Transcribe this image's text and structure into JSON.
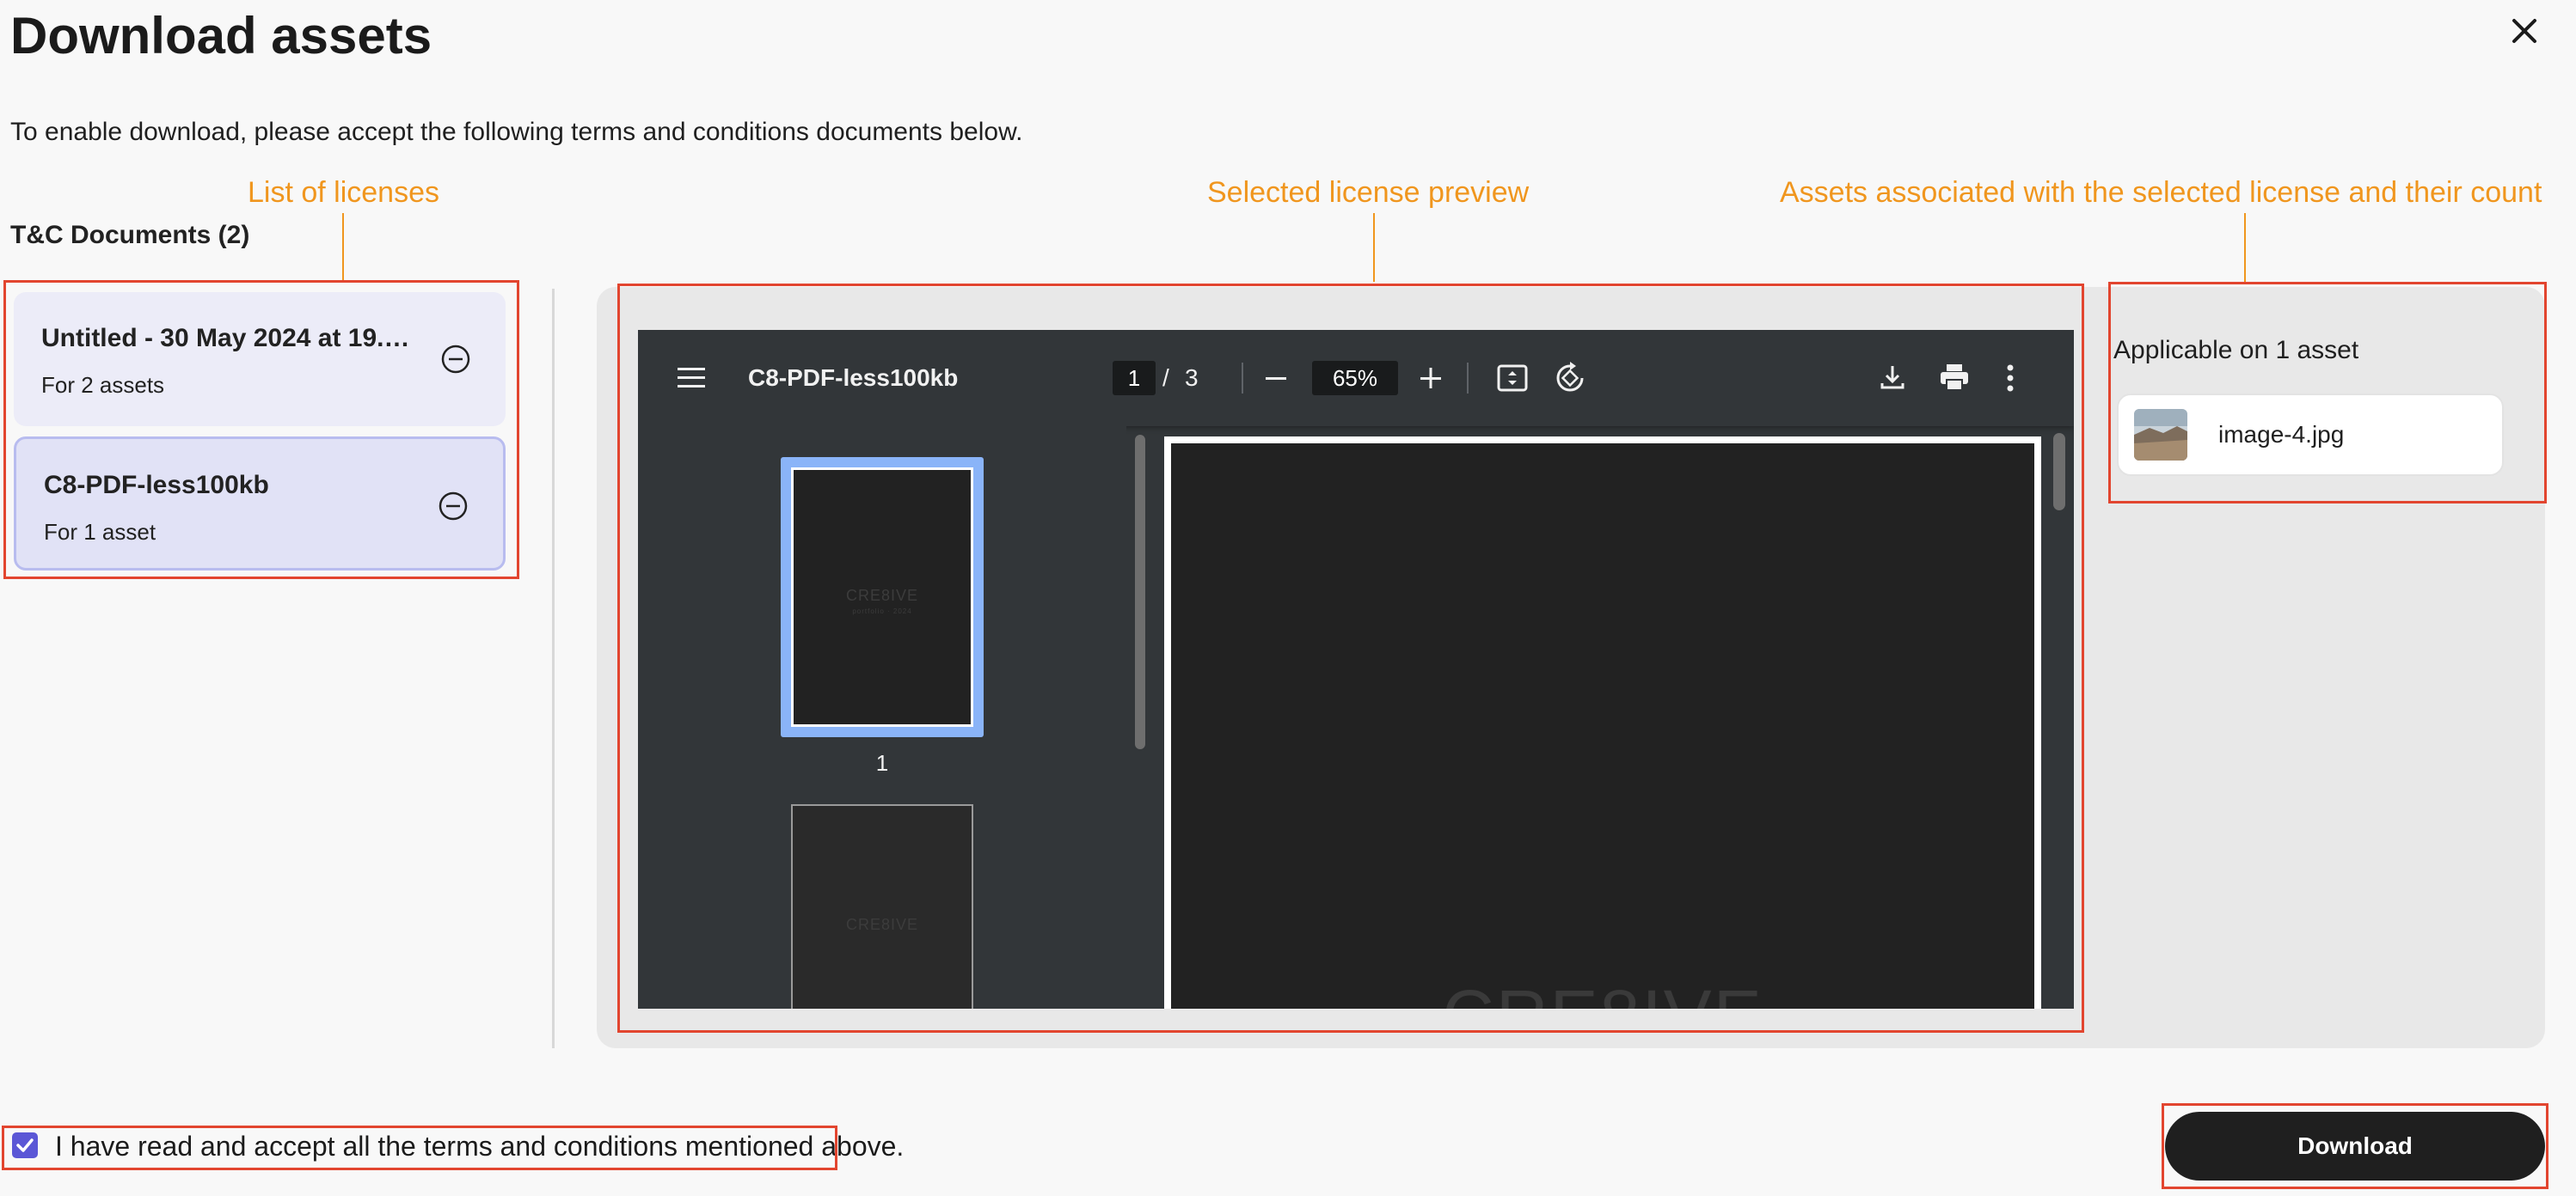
{
  "dialog": {
    "title": "Download assets",
    "subtitle": "To enable download, please accept the following terms and conditions documents below.",
    "close_icon": "close-icon"
  },
  "annotations": {
    "list_label": "List of licenses",
    "preview_label": "Selected license preview",
    "assets_label": "Assets associated with the selected license and their count",
    "color": "#f0961e",
    "box_color": "#e2452f"
  },
  "documents": {
    "heading": "T&C Documents (2)",
    "items": [
      {
        "name": "Untitled - 30 May 2024 at 19.15...",
        "count": "For 2 assets",
        "selected": false
      },
      {
        "name": "C8-PDF-less100kb",
        "count": "For 1 asset",
        "selected": true
      }
    ]
  },
  "viewer": {
    "filename": "C8-PDF-less100kb",
    "page_current": "1",
    "page_sep": "/",
    "page_total": "3",
    "zoom": "65%",
    "thumb_label": "1",
    "watermark": "CRE8IVE",
    "watermark_sub": "portfolio · 2024",
    "icons": [
      "menu-icon",
      "zoom-out-icon",
      "zoom-in-icon",
      "fit-page-icon",
      "rotate-icon",
      "download-icon",
      "print-icon",
      "more-icon"
    ]
  },
  "assets_panel": {
    "applicable_text": "Applicable on 1 asset",
    "assets": [
      {
        "name": "image-4.jpg"
      }
    ]
  },
  "footer": {
    "accept_text": "I have read and accept all the terms and conditions mentioned above.",
    "accepted": true,
    "download_label": "Download"
  },
  "colors": {
    "accent": "#5b57d6",
    "selected_card_bg": "#e1e2f6",
    "selected_card_border": "#b8bcef",
    "thumb_highlight": "#8ab4f8",
    "button_bg": "#1f1f1f"
  }
}
